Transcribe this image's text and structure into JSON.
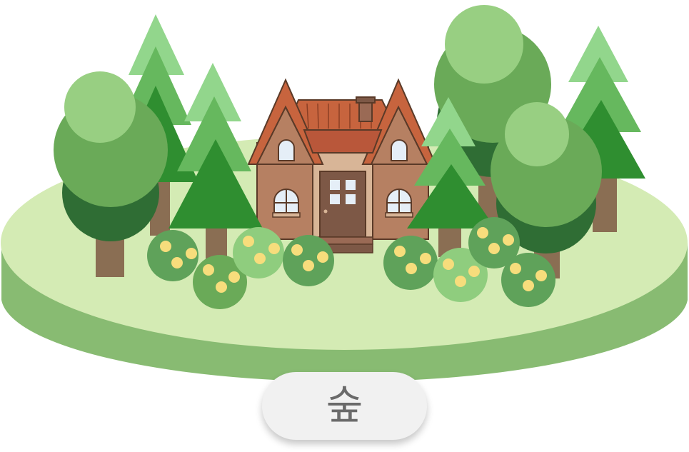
{
  "label": {
    "text": "숲"
  },
  "colors": {
    "ground_top": "#d4ebb4",
    "ground_side": "#88bb72",
    "pine_light": "#92d68c",
    "pine_mid": "#66b85e",
    "pine_dark": "#2f8e30",
    "round_light": "#98cf82",
    "round_mid": "#6aaa58",
    "round_dark": "#2f6d34",
    "trunk": "#8a6e53",
    "house_wall": "#b68062",
    "house_trim": "#d8b597",
    "roof": "#c7643e",
    "door": "#7d5846",
    "window": "#e5eef7",
    "bush_dark": "#5fa25a",
    "bush_light": "#8fcd7e",
    "flower": "#f7dd7c",
    "flower_center": "#f0b44a"
  },
  "icons": [
    "house-icon",
    "pine-tree-icon",
    "round-tree-icon",
    "flower-bush-icon",
    "island-ground-icon"
  ]
}
